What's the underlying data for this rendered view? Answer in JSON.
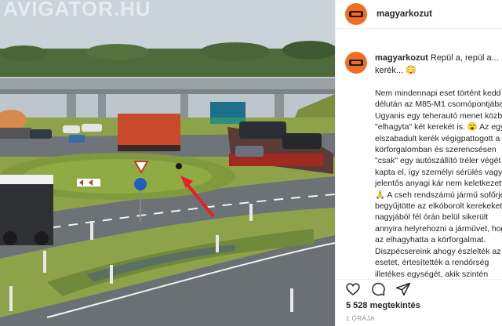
{
  "media": {
    "watermark": "AVIGATOR.HU",
    "scene": "dashcam-still"
  },
  "post": {
    "username": "magyarkozut",
    "avatar_color": "#f26d21",
    "caption_title": "Repül a, repül a... kerék... 😳",
    "caption_body": "Nem mindennapi eset történt kedd délután az M85-M1 csomópontjában. Ugyanis egy teherautó menet közben \"elhagyta\" két kerekét is. 😮 Az egyik elszabadult kerék végigpattogott a körforgalomban és szerencsésen \"csak\" egy autószállító tréler végét kapta el, így személyi sérülés vagy jelentős anyagi kár nem keletkezett. 🙏 A cseh rendszámú jármű sofőrje begyűjtötte az elkóborolt kerekeket, nagyjából fél órán belül sikerült annyira helyrehozni a járművet, hogy az elhagyhatta a körforgalmat. Diszpécsereink ahogy észlelték az esetet, értesítették a rendőrség illetékes egységét, akik szintén",
    "views": "5 528 megtekintés",
    "time_ago": "1 ÓRÁJA"
  },
  "icons": {
    "like": "heart-icon",
    "comment": "comment-icon",
    "share": "share-icon"
  }
}
